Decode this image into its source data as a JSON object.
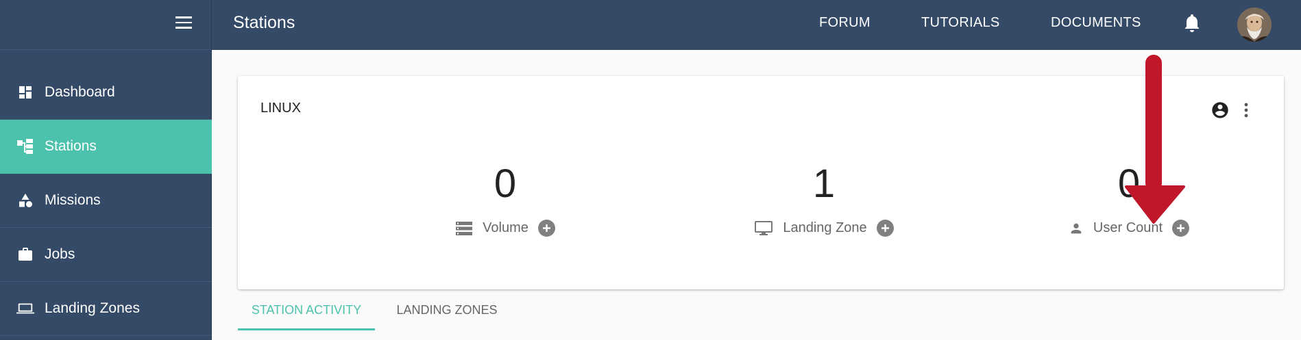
{
  "sidebar": {
    "items": [
      {
        "label": "Dashboard",
        "icon": "dashboard-icon",
        "active": false
      },
      {
        "label": "Stations",
        "icon": "stations-icon",
        "active": true
      },
      {
        "label": "Missions",
        "icon": "shapes-icon",
        "active": false
      },
      {
        "label": "Jobs",
        "icon": "briefcase-icon",
        "active": false
      },
      {
        "label": "Landing Zones",
        "icon": "laptop-icon",
        "active": false
      }
    ]
  },
  "header": {
    "title": "Stations",
    "links": [
      "FORUM",
      "TUTORIALS",
      "DOCUMENTS"
    ]
  },
  "card": {
    "title": "LINUX",
    "stats": [
      {
        "value": "0",
        "label": "Volume",
        "icon": "storage-icon"
      },
      {
        "value": "1",
        "label": "Landing Zone",
        "icon": "monitor-icon"
      },
      {
        "value": "0",
        "label": "User Count",
        "icon": "person-icon"
      }
    ]
  },
  "tabs": [
    "STATION ACTIVITY",
    "LANDING ZONES"
  ],
  "colors": {
    "sidebar": "#354a66",
    "accent": "#4cc2ad",
    "annotation": "#c0172b"
  }
}
